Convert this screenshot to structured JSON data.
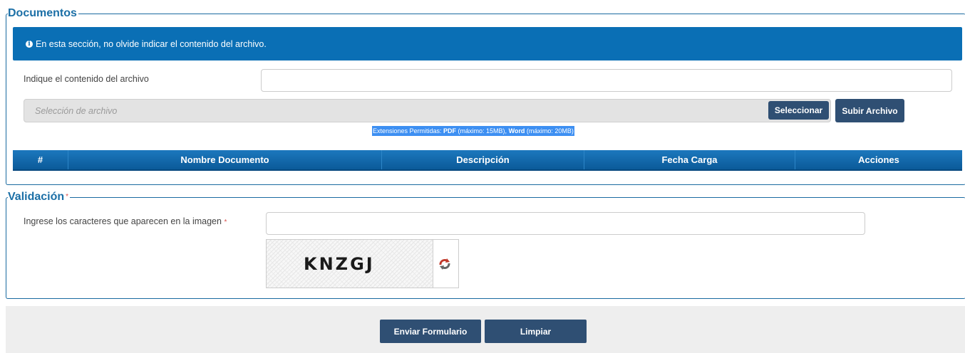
{
  "documentos": {
    "legend": "Documentos",
    "alert_text": "En esta sección, no olvide indicar el contenido del archivo.",
    "content_label": "Indique el contenido del archivo",
    "content_value": "",
    "file_placeholder": "Selección de archivo",
    "select_button": "Seleccionar",
    "upload_button": "Subir Archivo",
    "ext_prefix": "Extensiones Permitidas: ",
    "ext_pdf": "PDF",
    "ext_pdf_limit": " (máximo: 15MB), ",
    "ext_word": "Word",
    "ext_word_limit": " (máximo: 20MB)",
    "table_headers": [
      "#",
      "Nombre Documento",
      "Descripción",
      "Fecha Carga",
      "Acciones"
    ]
  },
  "validacion": {
    "legend": "Validación",
    "required_mark": "*",
    "captcha_label": "Ingrese los caracteres que aparecen en la imagen",
    "captcha_required": "*",
    "captcha_value": "",
    "captcha_text": "KNZGJ"
  },
  "footer": {
    "submit_button": "Enviar Formulario",
    "clear_button": "Limpiar"
  },
  "colors": {
    "accent": "#1b6fa6",
    "alert_bg": "#0a6fb5",
    "button_dark": "#2f4f73",
    "required": "#d9534f"
  }
}
